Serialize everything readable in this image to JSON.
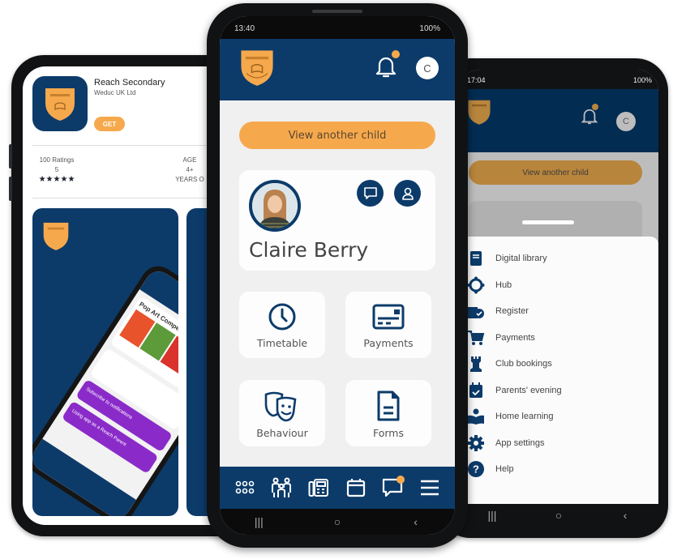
{
  "colors": {
    "brand_navy": "#0c3b6a",
    "brand_orange": "#f6a94c",
    "screen_bg": "#f0f0f0",
    "menu_icon": "#0c3b6a"
  },
  "app_store": {
    "app_name": "Reach Secondary",
    "developer": "Weduc UK Ltd",
    "get_label": "GET",
    "ratings_label": "100 Ratings",
    "rating_value": "5",
    "stars": "★★★★★",
    "age_label": "AGE",
    "age_value": "4+",
    "age_unit": "YEARS O",
    "screenshot": {
      "post_title": "Pop Art Competition",
      "notification_1": "Subscribe to notifications",
      "notification_2": "Using app as a Reach Parent"
    }
  },
  "center_phone": {
    "status": {
      "time": "13:40",
      "battery": "100%"
    },
    "avatar_initial": "C",
    "view_another_child": "View another child",
    "child_name": "Claire Berry",
    "tiles": [
      {
        "label": "Timetable",
        "icon": "clock-icon"
      },
      {
        "label": "Payments",
        "icon": "payment-card-icon"
      },
      {
        "label": "Behaviour",
        "icon": "theatre-masks-icon"
      },
      {
        "label": "Forms",
        "icon": "document-icon"
      }
    ],
    "bottom_nav": [
      "apps-grid-icon",
      "family-icon",
      "fax-icon",
      "calendar-icon",
      "chat-icon",
      "menu-icon"
    ],
    "system_nav": {
      "recents": "|||",
      "home": "○",
      "back": "‹"
    }
  },
  "right_phone": {
    "status": {
      "time": "17:04",
      "battery": "100%"
    },
    "avatar_initial": "C",
    "view_another_child": "View another child",
    "menu": [
      {
        "label": "Digital library",
        "icon": "book-icon"
      },
      {
        "label": "Hub",
        "icon": "hub-icon"
      },
      {
        "label": "Register",
        "icon": "register-icon"
      },
      {
        "label": "Payments",
        "icon": "cart-icon"
      },
      {
        "label": "Club bookings",
        "icon": "rook-icon"
      },
      {
        "label": "Parents' evening",
        "icon": "calendar-check-icon"
      },
      {
        "label": "Home learning",
        "icon": "reader-icon"
      },
      {
        "label": "App settings",
        "icon": "gear-icon"
      },
      {
        "label": "Help",
        "icon": "help-icon"
      }
    ],
    "system_nav": {
      "recents": "|||",
      "home": "○",
      "back": "‹"
    }
  }
}
